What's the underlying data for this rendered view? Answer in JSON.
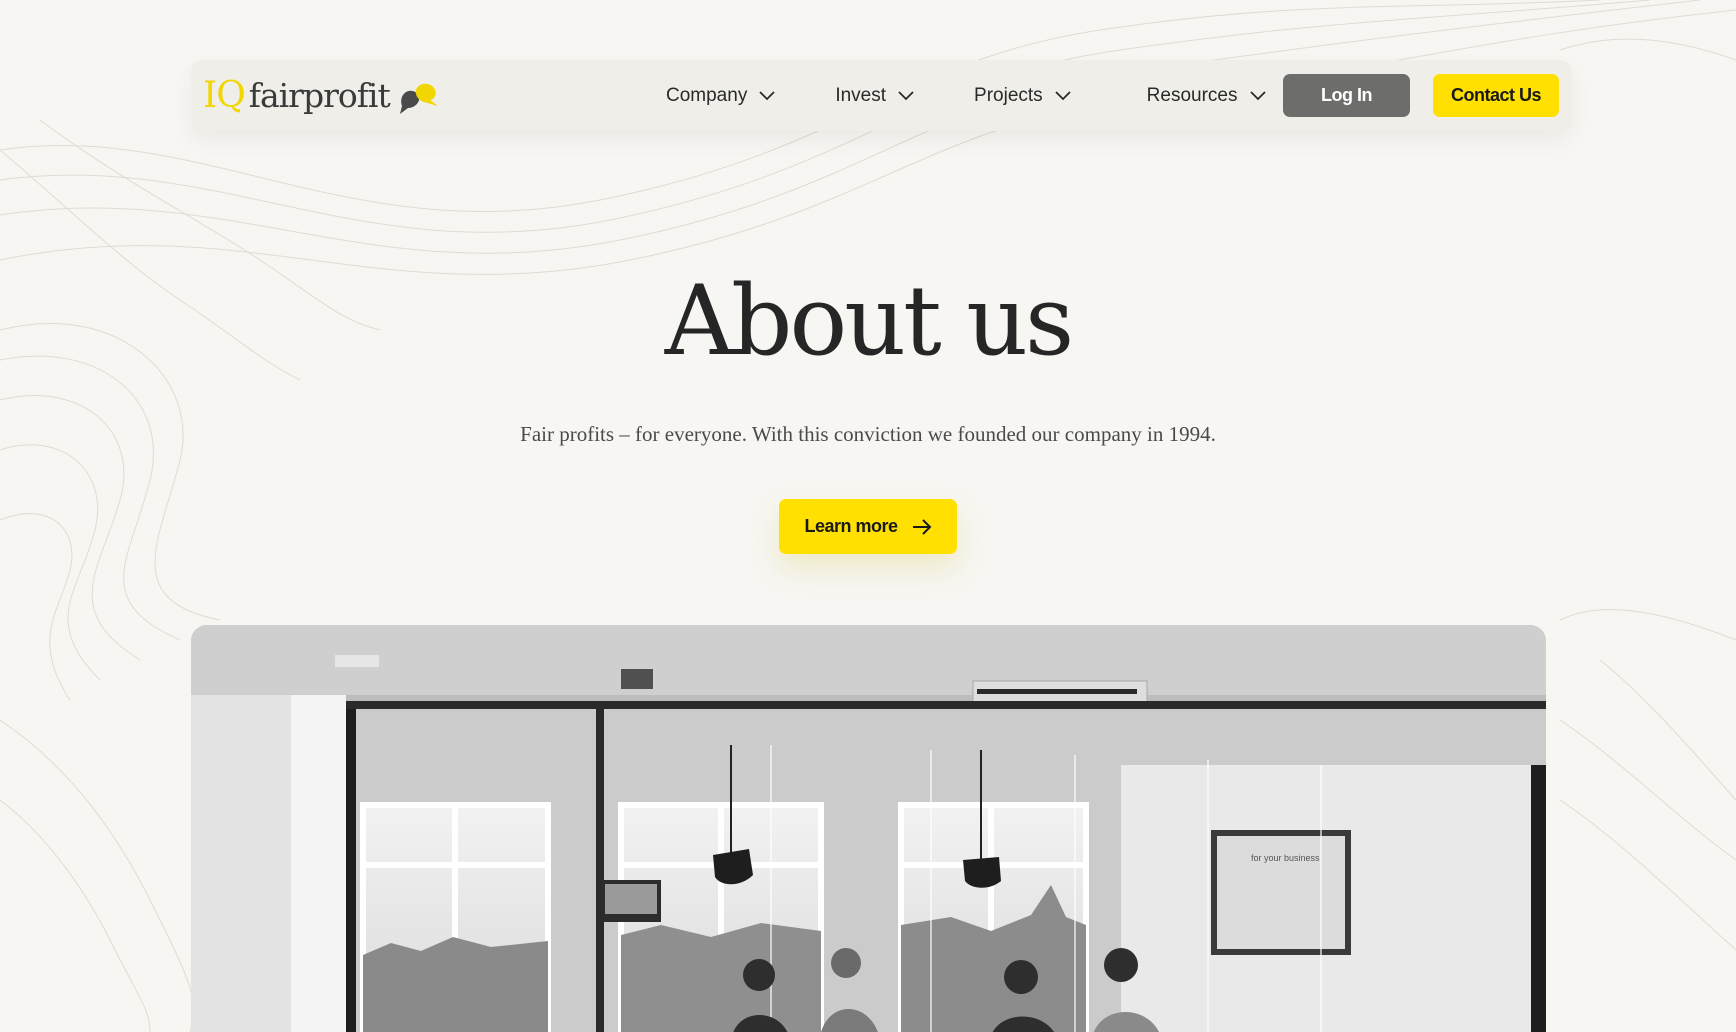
{
  "header": {
    "logo": {
      "prefix": "IQ",
      "word": "fairprofit"
    },
    "menu": [
      {
        "label": "Company"
      },
      {
        "label": "Invest"
      },
      {
        "label": "Projects"
      },
      {
        "label": "Resources"
      }
    ],
    "login_label": "Log In",
    "contact_label": "Contact Us"
  },
  "hero": {
    "title": "About us",
    "subtitle": "Fair profits – for everyone. With this conviction we founded our company in 1994.",
    "cta_label": "Learn more"
  },
  "photo": {
    "screen_text": "for your business"
  },
  "colors": {
    "background": "#f7f6f2",
    "accent_yellow": "#ffe000",
    "login_gray": "#6d6d6c",
    "text_dark": "#262626"
  },
  "icons": [
    "chevron-down-icon",
    "arrow-right-icon",
    "speech-bubbles-icon"
  ]
}
